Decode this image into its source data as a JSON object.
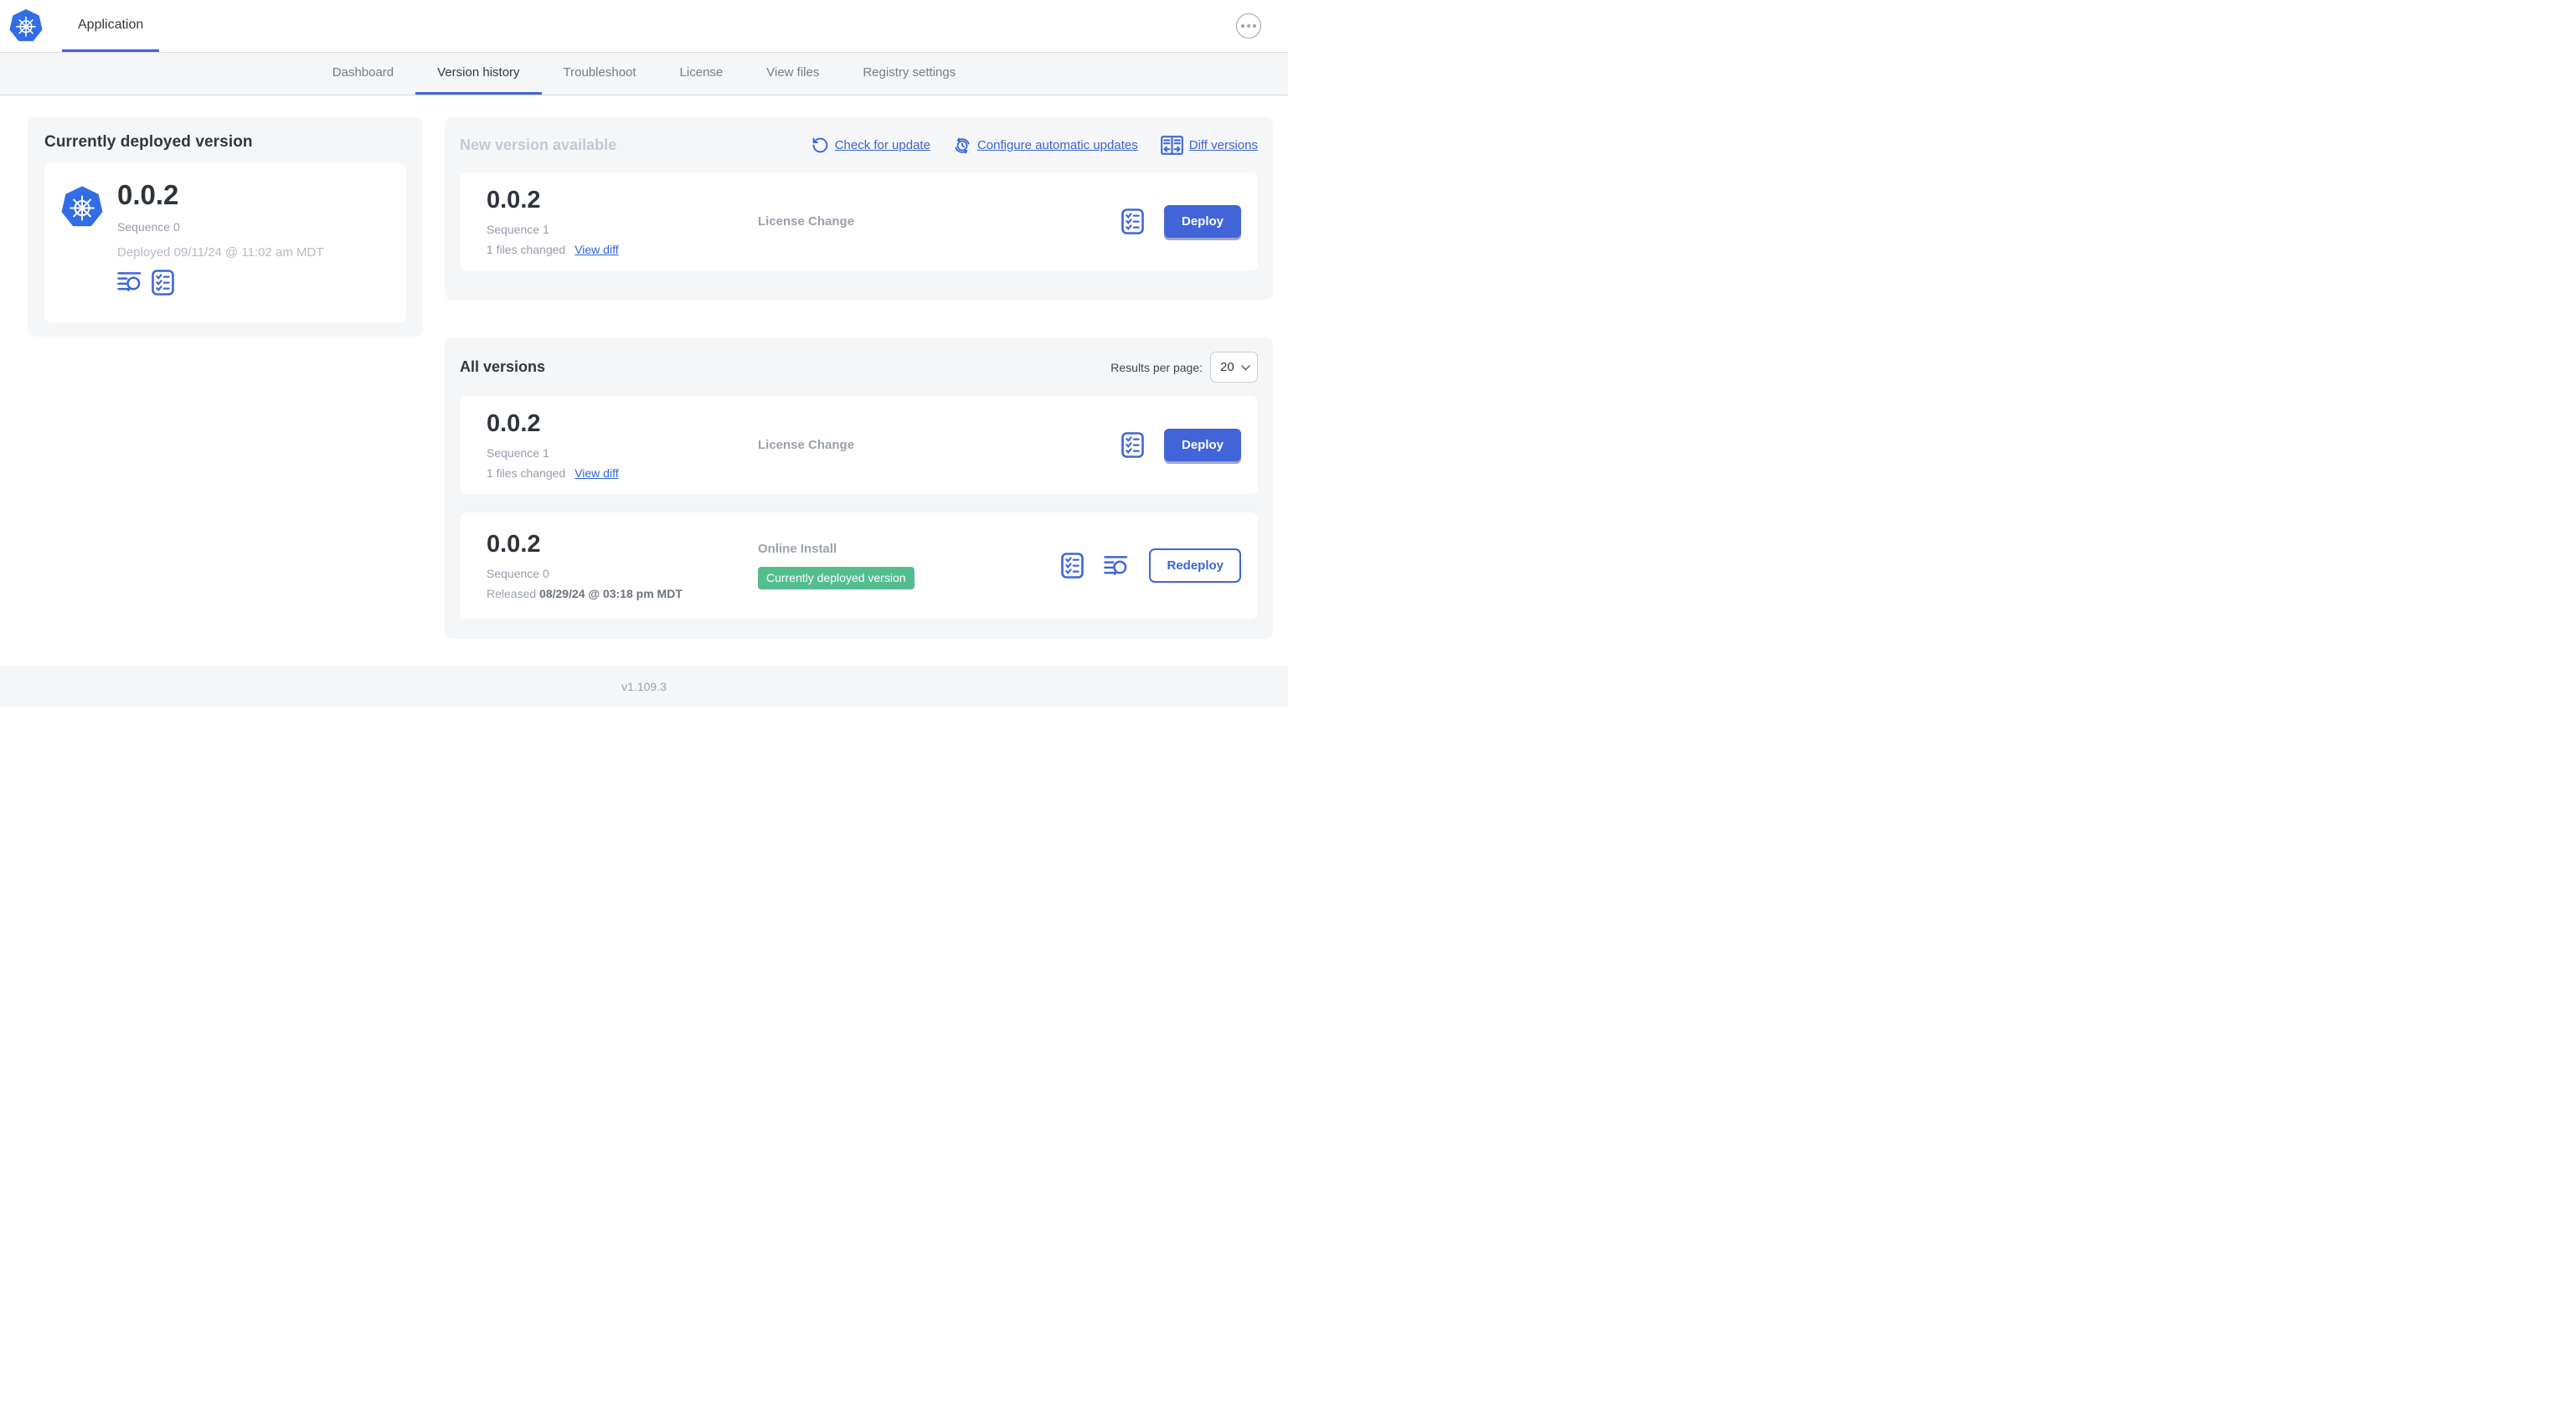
{
  "header": {
    "app_title": "Application"
  },
  "nav": {
    "active_index": 1,
    "tabs": [
      {
        "label": "Dashboard"
      },
      {
        "label": "Version history"
      },
      {
        "label": "Troubleshoot"
      },
      {
        "label": "License"
      },
      {
        "label": "View files"
      },
      {
        "label": "Registry settings"
      }
    ]
  },
  "current_version_panel": {
    "title": "Currently deployed version",
    "version": "0.0.2",
    "sequence": "Sequence 0",
    "deployed": "Deployed 09/11/24 @ 11:02 am MDT",
    "icons": [
      "deploy-logs",
      "preflight-checks"
    ]
  },
  "new_version_section": {
    "title": "New version available",
    "check_for_update": "Check for update",
    "configure_automatic_updates": "Configure automatic updates",
    "diff_versions": "Diff versions",
    "card": {
      "version": "0.0.2",
      "sequence": "Sequence 1",
      "files_changed": "1 files changed",
      "view_diff": "View diff",
      "change_type": "License Change",
      "deploy": "Deploy"
    }
  },
  "all_versions_section": {
    "title": "All versions",
    "results_per_page_label": "Results per page:",
    "results_per_page_value": "20",
    "card_sequence_1": {
      "version": "0.0.2",
      "sequence": "Sequence 1",
      "files_changed": "1 files changed",
      "view_diff": "View diff",
      "change_type": "License Change",
      "deploy": "Deploy"
    },
    "card_sequence_0": {
      "version": "0.0.2",
      "sequence": "Sequence 0",
      "released_label": "Released",
      "released_date": "08/29/24 @ 03:18 pm MDT",
      "install_type": "Online Install",
      "badge": "Currently deployed version",
      "redeploy": "Redeploy"
    }
  },
  "footer": {
    "app_version": "v1.109.3"
  },
  "colors": {
    "accent_blue": "#3b63d3",
    "button_blue": "#4164d9",
    "kubernetes_blue": "#326de6",
    "badge_green": "#54bd8e",
    "section_gray": "#f5f6f8"
  }
}
